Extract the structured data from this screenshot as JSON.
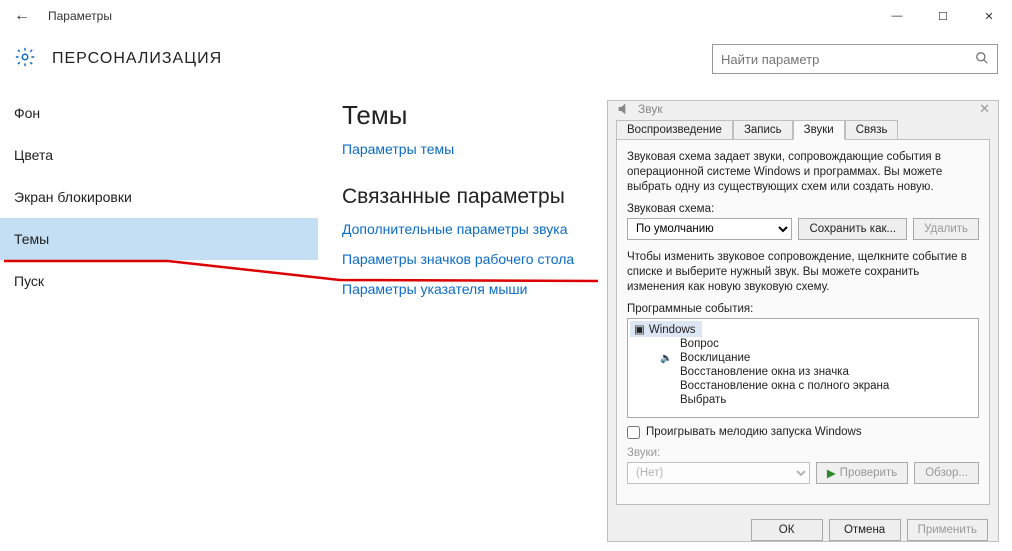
{
  "window": {
    "title": "Параметры",
    "controls": {
      "min": "—",
      "max": "☐",
      "close": "✕"
    }
  },
  "header": {
    "category": "ПЕРСОНАЛИЗАЦИЯ",
    "search_placeholder": "Найти параметр"
  },
  "sidebar": {
    "items": [
      {
        "label": "Фон",
        "active": false
      },
      {
        "label": "Цвета",
        "active": false
      },
      {
        "label": "Экран блокировки",
        "active": false
      },
      {
        "label": "Темы",
        "active": true
      },
      {
        "label": "Пуск",
        "active": false
      }
    ]
  },
  "main": {
    "heading1": "Темы",
    "link1": "Параметры темы",
    "heading2": "Связанные параметры",
    "link2": "Дополнительные параметры звука",
    "link3": "Параметры значков рабочего стола",
    "link4": "Параметры указателя мыши"
  },
  "sound": {
    "title": "Звук",
    "tabs": [
      "Воспроизведение",
      "Запись",
      "Звуки",
      "Связь"
    ],
    "active_tab": 2,
    "description": "Звуковая схема задает звуки, сопровождающие события в операционной системе Windows и программах. Вы можете выбрать одну из существующих схем или создать новую.",
    "scheme_label": "Звуковая схема:",
    "scheme_value": "По умолчанию",
    "save_as": "Сохранить как...",
    "delete": "Удалить",
    "change_hint": "Чтобы изменить звуковое сопровождение, щелкните событие в списке и выберите нужный звук. Вы можете сохранить изменения как новую звуковую схему.",
    "events_label": "Программные события:",
    "events": {
      "root": "Windows",
      "children": [
        "Вопрос",
        "Восклицание",
        "Восстановление окна из значка",
        "Восстановление окна с полного экрана",
        "Выбрать"
      ]
    },
    "play_startup": "Проигрывать мелодию запуска Windows",
    "sounds_label": "Звуки:",
    "sounds_value": "(Нет)",
    "test": "Проверить",
    "browse": "Обзор...",
    "ok": "ОК",
    "cancel": "Отмена",
    "apply": "Применить"
  }
}
